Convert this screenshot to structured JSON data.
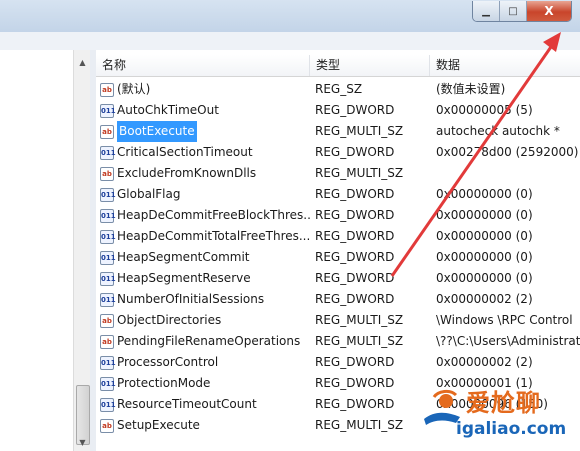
{
  "window": {
    "minimize_label": "▁",
    "maximize_label": "□",
    "close_label": "X"
  },
  "columns": {
    "name": "名称",
    "type": "类型",
    "data": "数据"
  },
  "rows": [
    {
      "icon": "ab",
      "name": "(默认)",
      "type": "REG_SZ",
      "data": "(数值未设置)"
    },
    {
      "icon": "bin",
      "name": "AutoChkTimeOut",
      "type": "REG_DWORD",
      "data": "0x00000005 (5)"
    },
    {
      "icon": "ab",
      "name": "BootExecute",
      "type": "REG_MULTI_SZ",
      "data": "autocheck autochk *",
      "selected": true
    },
    {
      "icon": "bin",
      "name": "CriticalSectionTimeout",
      "type": "REG_DWORD",
      "data": "0x00278d00 (2592000)"
    },
    {
      "icon": "ab",
      "name": "ExcludeFromKnownDlls",
      "type": "REG_MULTI_SZ",
      "data": ""
    },
    {
      "icon": "bin",
      "name": "GlobalFlag",
      "type": "REG_DWORD",
      "data": "0x00000000 (0)"
    },
    {
      "icon": "bin",
      "name": "HeapDeCommitFreeBlockThres...",
      "type": "REG_DWORD",
      "data": "0x00000000 (0)"
    },
    {
      "icon": "bin",
      "name": "HeapDeCommitTotalFreeThres...",
      "type": "REG_DWORD",
      "data": "0x00000000 (0)"
    },
    {
      "icon": "bin",
      "name": "HeapSegmentCommit",
      "type": "REG_DWORD",
      "data": "0x00000000 (0)"
    },
    {
      "icon": "bin",
      "name": "HeapSegmentReserve",
      "type": "REG_DWORD",
      "data": "0x00000000 (0)"
    },
    {
      "icon": "bin",
      "name": "NumberOfInitialSessions",
      "type": "REG_DWORD",
      "data": "0x00000002 (2)"
    },
    {
      "icon": "ab",
      "name": "ObjectDirectories",
      "type": "REG_MULTI_SZ",
      "data": "\\Windows \\RPC Control"
    },
    {
      "icon": "ab",
      "name": "PendingFileRenameOperations",
      "type": "REG_MULTI_SZ",
      "data": "\\??\\C:\\Users\\Administrato"
    },
    {
      "icon": "bin",
      "name": "ProcessorControl",
      "type": "REG_DWORD",
      "data": "0x00000002 (2)"
    },
    {
      "icon": "bin",
      "name": "ProtectionMode",
      "type": "REG_DWORD",
      "data": "0x00000001 (1)"
    },
    {
      "icon": "bin",
      "name": "ResourceTimeoutCount",
      "type": "REG_DWORD",
      "data": "0x00000096 (150)"
    },
    {
      "icon": "ab",
      "name": "SetupExecute",
      "type": "REG_MULTI_SZ",
      "data": ""
    }
  ],
  "watermark": {
    "text": "爱尬聊",
    "url": "igaliao.com"
  },
  "colors": {
    "selection": "#3399ff",
    "arrow": "#e23a3a",
    "close": "#c9452b"
  }
}
